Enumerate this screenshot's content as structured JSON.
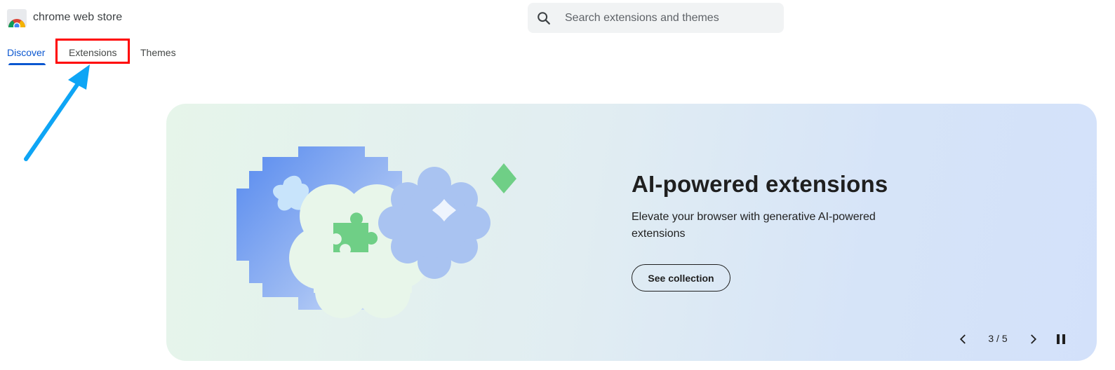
{
  "header": {
    "brand": "chrome web store",
    "logo_icon": "chrome-web-store-logo-icon",
    "search": {
      "placeholder": "Search extensions and themes",
      "value": "",
      "icon": "search-icon"
    }
  },
  "nav": {
    "tabs": [
      {
        "label": "Discover",
        "active": true
      },
      {
        "label": "Extensions",
        "active": false
      },
      {
        "label": "Themes",
        "active": false
      }
    ]
  },
  "hero": {
    "title": "AI-powered extensions",
    "description": "Elevate your browser with generative AI-powered extensions",
    "cta_label": "See collection",
    "counter": "3 / 5"
  },
  "colors": {
    "accent": "#0b57d0",
    "annotation_box": "#ff0000",
    "annotation_arrow": "#0ea5f5"
  }
}
